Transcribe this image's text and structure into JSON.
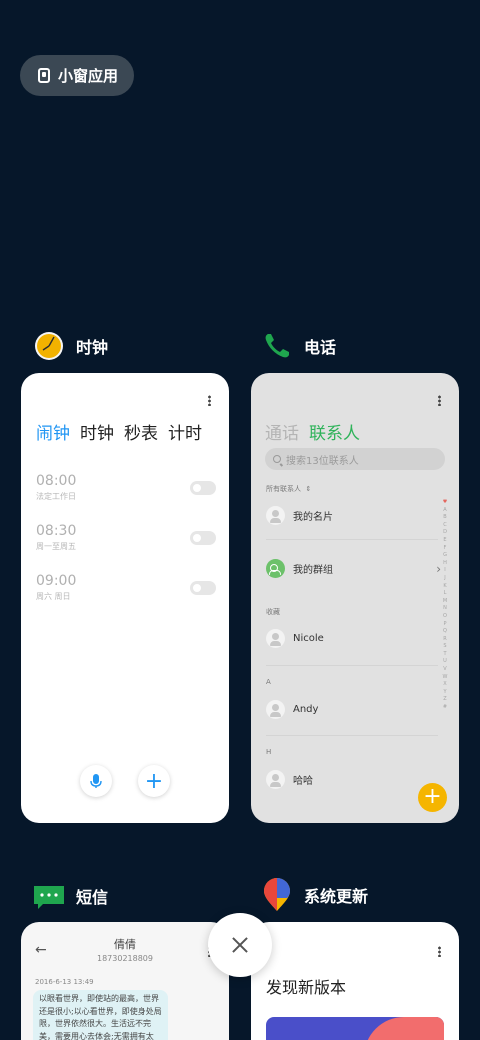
{
  "floating_window_button": {
    "label": "小窗应用",
    "icon": "floating-window-icon"
  },
  "apps": {
    "clock": {
      "name": "时钟",
      "icon": "clock-app-icon",
      "tabs": [
        "闹钟",
        "时钟",
        "秒表",
        "计时"
      ],
      "active_tab": "闹钟",
      "alarms": [
        {
          "time": "08:00",
          "repeat": "法定工作日",
          "enabled": false
        },
        {
          "time": "08:30",
          "repeat": "周一至周五",
          "enabled": false
        },
        {
          "time": "09:00",
          "repeat": "周六 周日",
          "enabled": false
        }
      ],
      "actions": {
        "voice": "mic-icon",
        "add": "+"
      }
    },
    "phone": {
      "name": "电话",
      "icon": "phone-app-icon",
      "tabs": [
        "通话",
        "联系人"
      ],
      "active_tab": "联系人",
      "search_placeholder": "搜索13位联系人",
      "filter_label": "所有联系人",
      "rows": {
        "my_card": "我的名片",
        "my_groups": "我的群组",
        "favorites_header": "收藏",
        "fav_contact": "Nicole",
        "section_a": "A",
        "contact_a": "Andy",
        "section_h": "H",
        "contact_h": "哈哈"
      },
      "alphabet": [
        "♥",
        "A",
        "B",
        "C",
        "D",
        "E",
        "F",
        "G",
        "H",
        "I",
        "J",
        "K",
        "L",
        "M",
        "N",
        "O",
        "P",
        "Q",
        "R",
        "S",
        "T",
        "U",
        "V",
        "W",
        "X",
        "Y",
        "Z",
        "#"
      ],
      "fab": "+",
      "accent": "#2fb35a"
    },
    "sms": {
      "name": "短信",
      "icon": "sms-app-icon",
      "contact": "倩倩",
      "number": "18730218809",
      "timestamp": "2016-6-13 13:49",
      "message": "以眼看世界，即使站的最高，世界还是很小;以心看世界，即使身处局限，世界依然很大。生活远不完美，需要用心去体会;无需拥有太多，愿"
    },
    "update": {
      "name": "系统更新",
      "icon": "system-update-icon",
      "title": "发现新版本"
    }
  },
  "close_all": "close-icon"
}
